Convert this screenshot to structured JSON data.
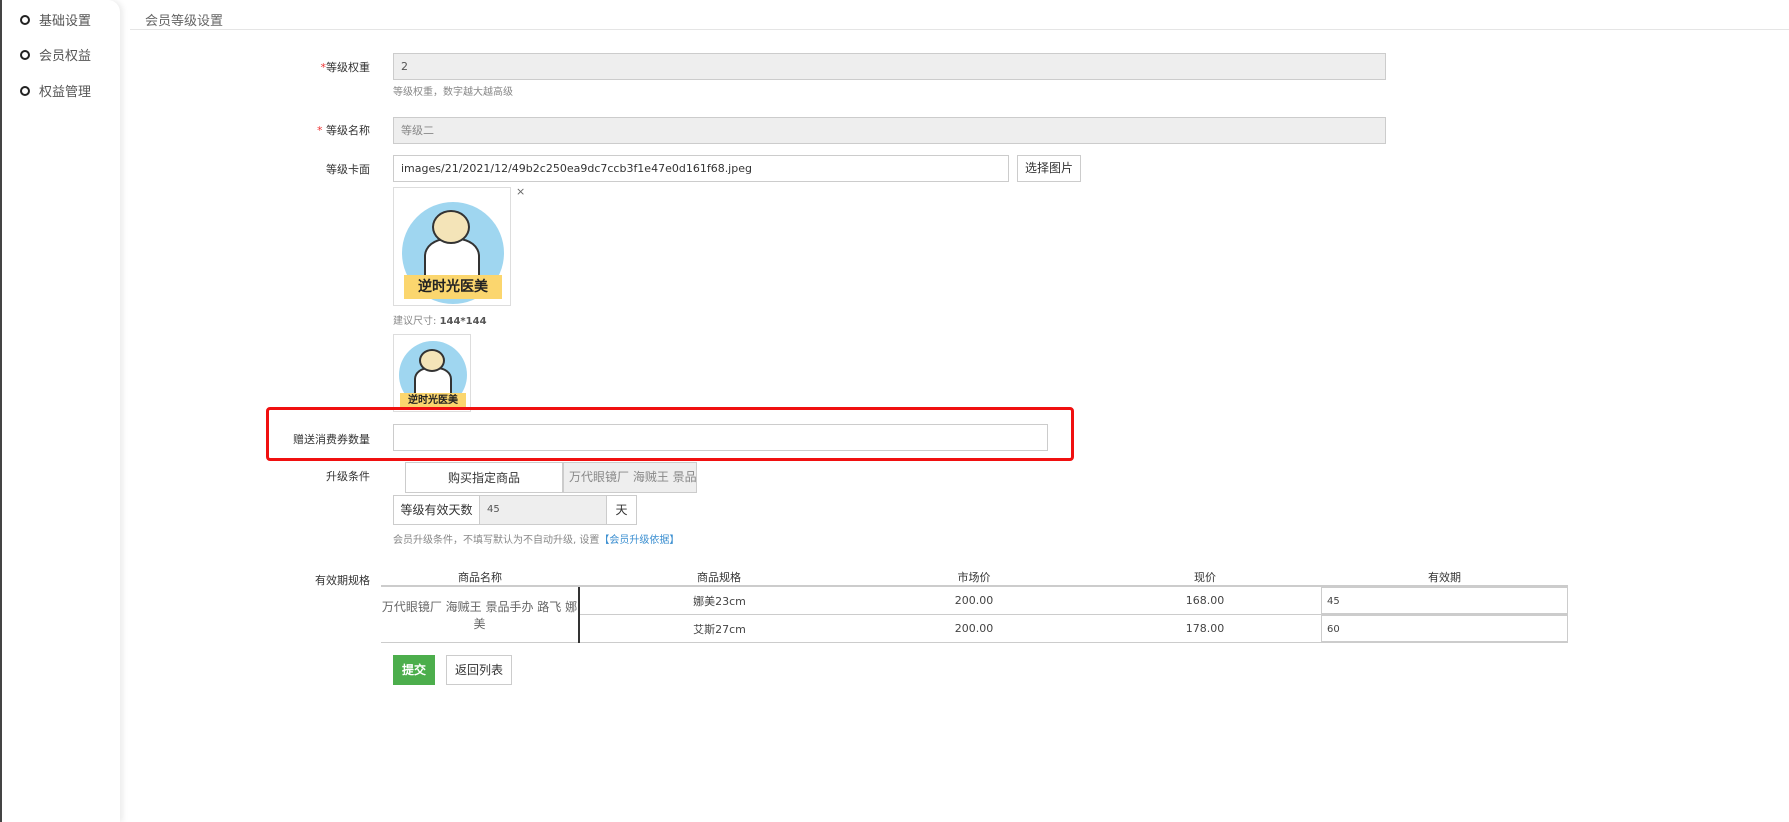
{
  "sidebar": {
    "items": [
      {
        "label": "基础设置"
      },
      {
        "label": "会员权益"
      },
      {
        "label": "权益管理"
      }
    ]
  },
  "header": {
    "title": "会员等级设置"
  },
  "form": {
    "weight": {
      "label": "等级权重",
      "value": "2",
      "help": "等级权重，数字越大越高级"
    },
    "name": {
      "label": "等级名称",
      "value": "等级二"
    },
    "card": {
      "label": "等级卡面",
      "value": "images/21/2021/12/49b2c250ea9dc7ccb3f1e47e0d161f68.jpeg",
      "choose_button": "选择图片",
      "remove": "×",
      "size_hint_prefix": "建议尺寸:",
      "size_hint_value": "144*144",
      "logo_text": "逆时光医美"
    },
    "coupon": {
      "label": "赠送消费券数量",
      "value": ""
    },
    "upgrade": {
      "label": "升级条件",
      "condition": "购买指定商品",
      "products": "万代眼镜厂 海贼王 景品手",
      "days_label": "等级有效天数",
      "days_value": "45",
      "days_unit": "天",
      "help": "会员升级条件，不填写默认为不自动升级, 设置",
      "help_link": "【会员升级依据】"
    },
    "validity": {
      "label": "有效期规格",
      "columns": [
        "商品名称",
        "商品规格",
        "市场价",
        "现价",
        "有效期"
      ],
      "product_name": "万代眼镜厂 海贼王 景品手办 路飞 娜美",
      "rows": [
        {
          "spec": "娜美23cm",
          "market": "200.00",
          "price": "168.00",
          "validity": "45"
        },
        {
          "spec": "艾斯27cm",
          "market": "200.00",
          "price": "178.00",
          "validity": "60"
        }
      ]
    },
    "submit": "提交",
    "back": "返回列表"
  },
  "colors": {
    "submit": "#4cae4c",
    "highlight": "#f01010",
    "link": "#3a8ed0"
  }
}
